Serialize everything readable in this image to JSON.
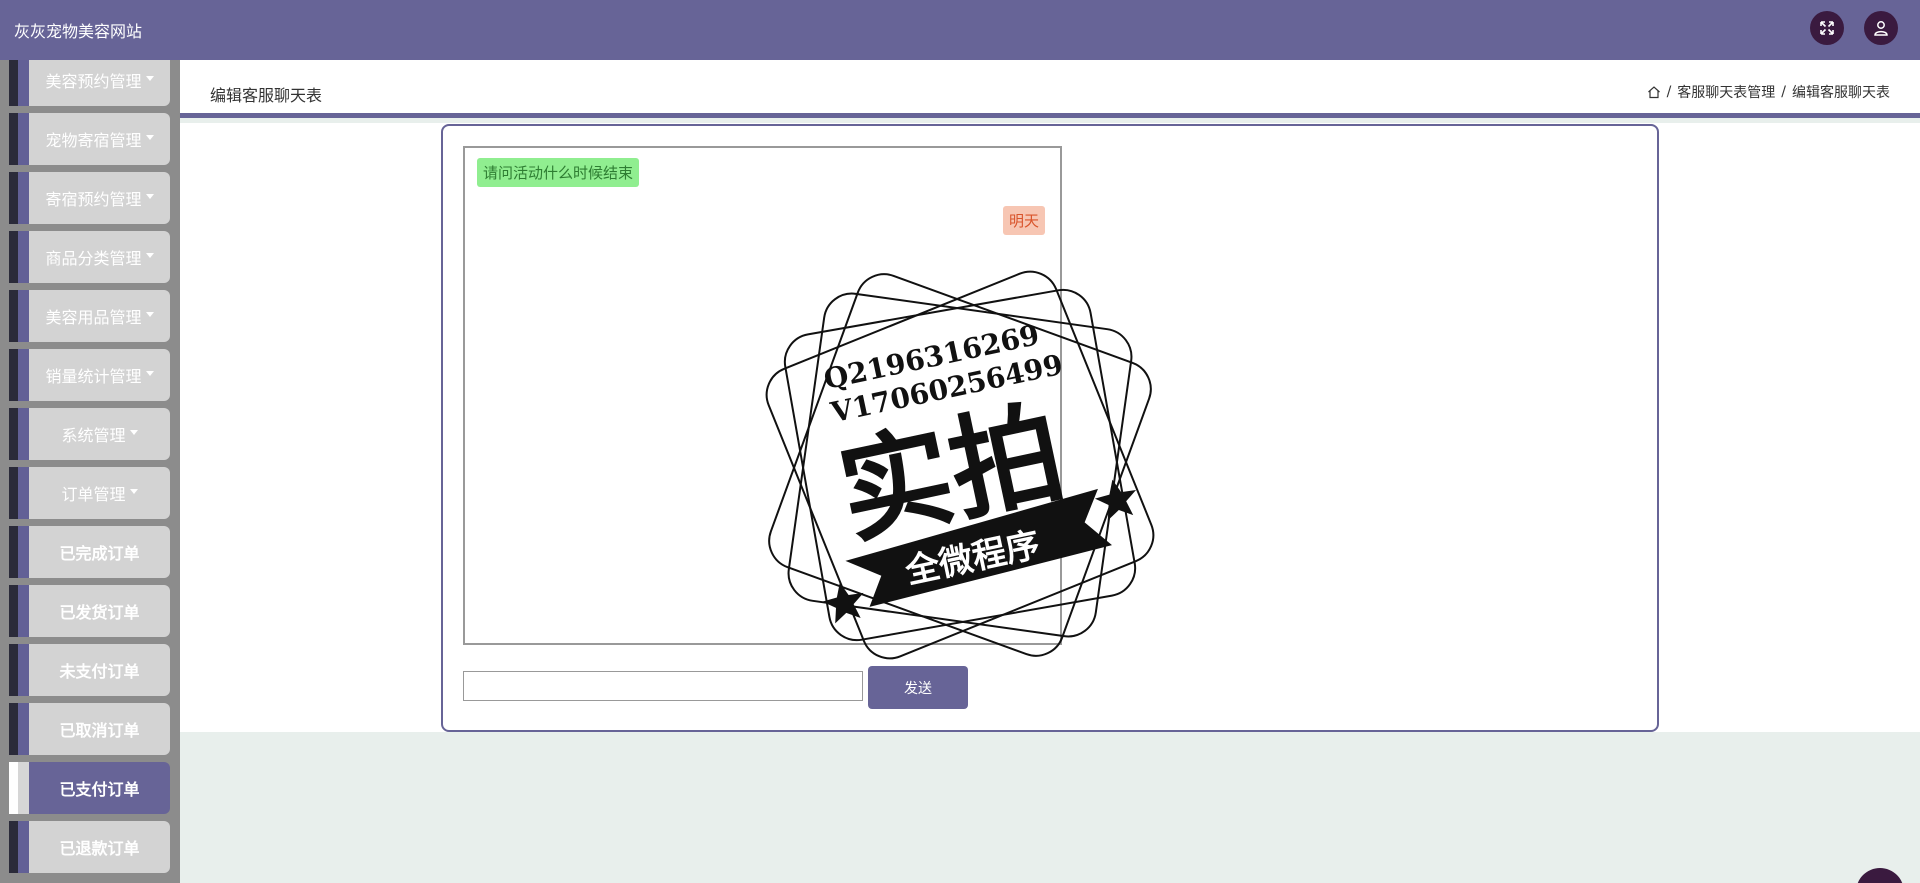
{
  "app": {
    "title": "灰灰宠物美容网站"
  },
  "header": {
    "fullscreen_icon": "fullscreen-icon",
    "user_icon": "user-icon"
  },
  "sidebar": {
    "items": [
      {
        "label": "美容预约管理",
        "has_caret": true
      },
      {
        "label": "宠物寄宿管理",
        "has_caret": true
      },
      {
        "label": "寄宿预约管理",
        "has_caret": true
      },
      {
        "label": "商品分类管理",
        "has_caret": true
      },
      {
        "label": "美容用品管理",
        "has_caret": true
      },
      {
        "label": "销量统计管理",
        "has_caret": true
      },
      {
        "label": "系统管理",
        "has_caret": true
      },
      {
        "label": "订单管理",
        "has_caret": true
      },
      {
        "label": "已完成订单",
        "has_caret": false
      },
      {
        "label": "已发货订单",
        "has_caret": false
      },
      {
        "label": "未支付订单",
        "has_caret": false
      },
      {
        "label": "已取消订单",
        "has_caret": false
      },
      {
        "label": "已支付订单",
        "has_caret": false,
        "active": true
      },
      {
        "label": "已退款订单",
        "has_caret": false
      }
    ]
  },
  "page": {
    "title": "编辑客服聊天表",
    "breadcrumb": {
      "home_icon": "home-icon",
      "items": [
        "客服聊天表管理",
        "编辑客服聊天表"
      ],
      "separator": "/"
    }
  },
  "chat": {
    "messages": [
      {
        "side": "left",
        "text": "请问活动什么时候结束"
      },
      {
        "side": "right",
        "text": "明天"
      }
    ],
    "input_value": "",
    "send_label": "发送"
  },
  "watermark": {
    "line1": "Q2196316269",
    "line2": "V17060256499",
    "big": "实拍",
    "banner": "全微程序"
  },
  "colors": {
    "primary": "#676497",
    "sidebar_bg": "#8c8c8c",
    "tile_bg": "#d3d3d3",
    "msg_left_bg": "#90ee90",
    "msg_right_bg": "#f7c6b3"
  }
}
